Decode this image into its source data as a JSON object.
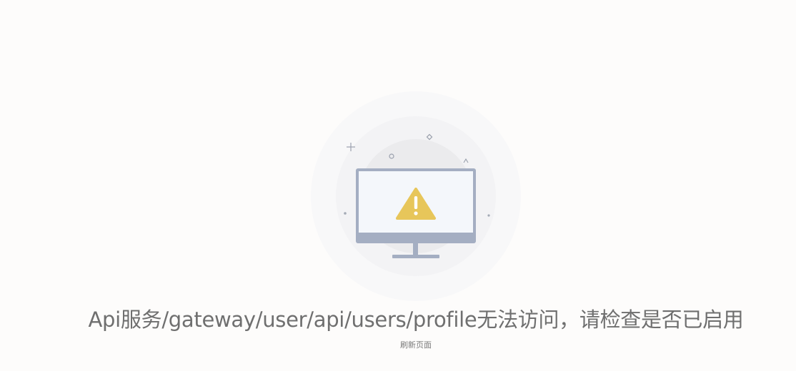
{
  "error": {
    "message": "Api服务/gateway/user/api/users/profile无法访问，请检查是否已启用",
    "refresh_label": "刷新页面"
  },
  "illustration": {
    "icon": "warning-triangle-icon",
    "device": "monitor-icon"
  },
  "colors": {
    "background": "#fdfcfb",
    "monitor_frame": "#a4aec2",
    "monitor_screen": "#f4f7fb",
    "warning": "#e7c65a",
    "text": "#6f6f6f"
  }
}
